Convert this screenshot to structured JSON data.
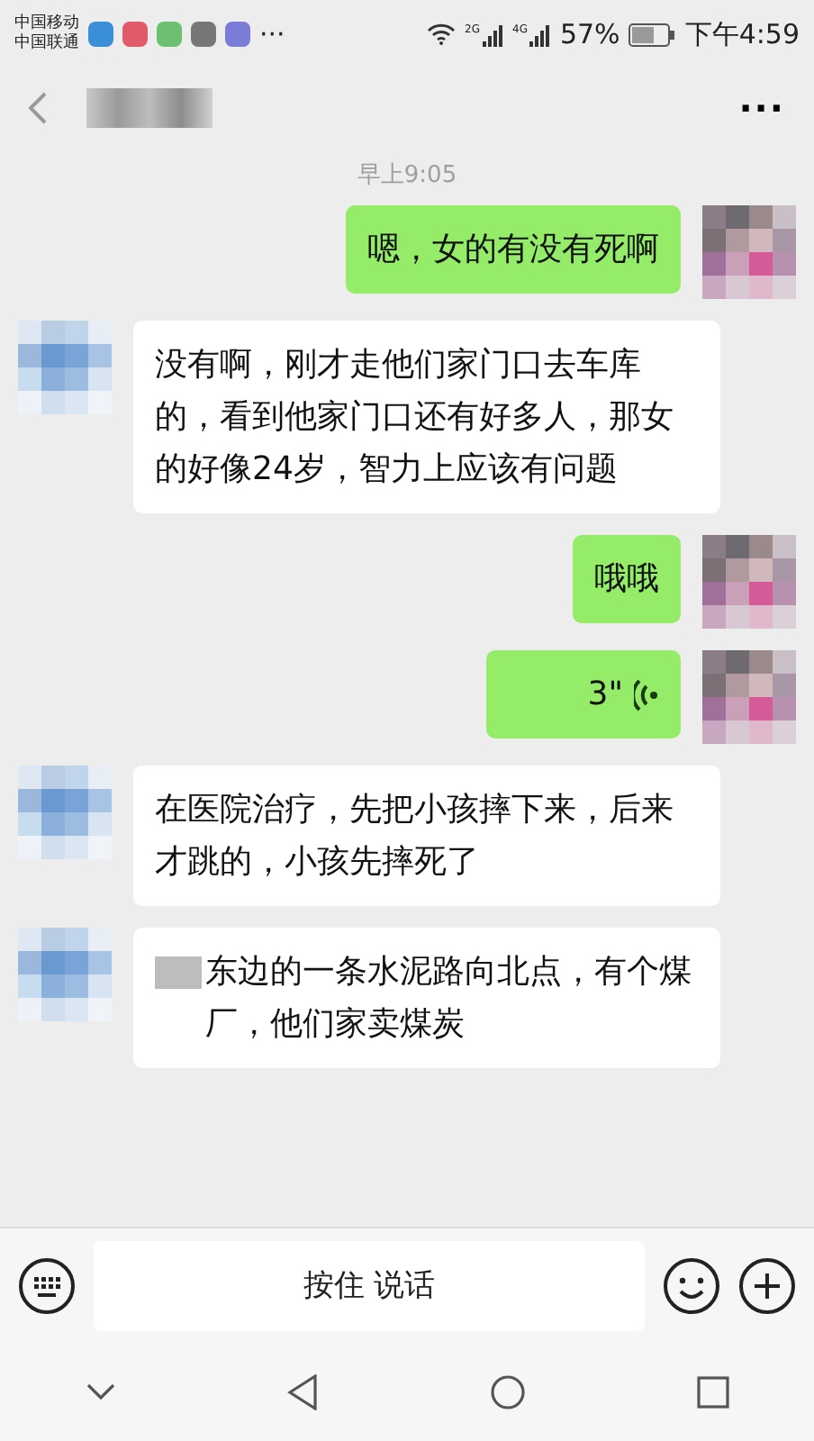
{
  "status_bar": {
    "carriers": [
      "中国移动",
      "中国联通"
    ],
    "more": "···",
    "signals": [
      "2G",
      "4G"
    ],
    "battery": "57%",
    "time": "下午4:59"
  },
  "header": {
    "more": "···"
  },
  "timestamp": "早上9:05",
  "messages": [
    {
      "from_me": true,
      "kind": "text",
      "text": "嗯，女的有没有死啊"
    },
    {
      "from_me": false,
      "kind": "text",
      "text": "没有啊，刚才走他们家门口去车库的，看到他家门口还有好多人，那女的好像24岁，智力上应该有问题"
    },
    {
      "from_me": true,
      "kind": "text",
      "text": "哦哦"
    },
    {
      "from_me": true,
      "kind": "voice",
      "text": "3\""
    },
    {
      "from_me": false,
      "kind": "text",
      "text": "在医院治疗，先把小孩摔下来，后来才跳的，小孩先摔死了"
    },
    {
      "from_me": false,
      "kind": "text",
      "redacted_prefix": true,
      "text": "东边的一条水泥路向北点，有个煤厂，他们家卖煤炭"
    }
  ],
  "input": {
    "placeholder": "按住 说话"
  }
}
